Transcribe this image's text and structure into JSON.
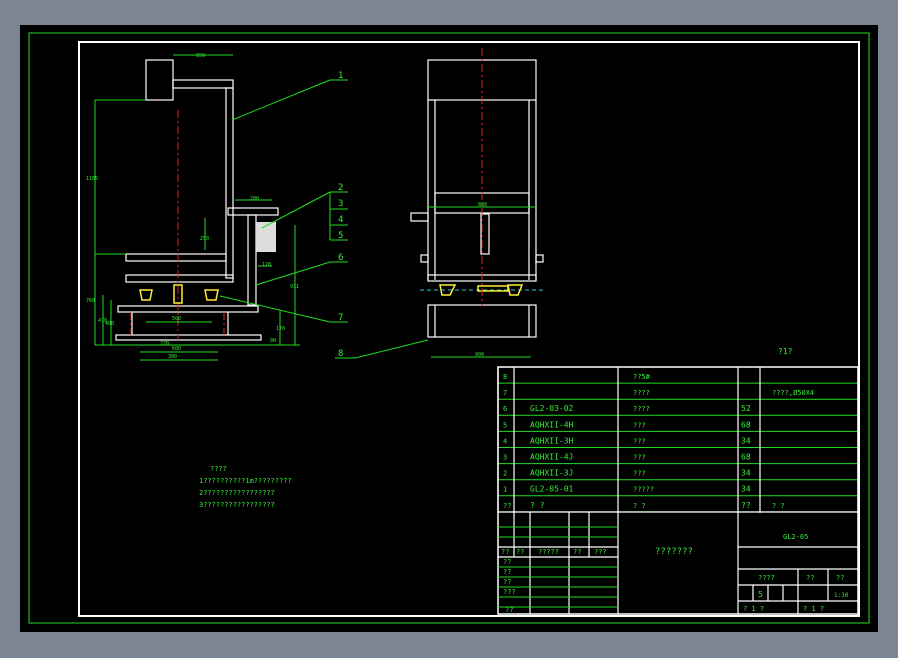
{
  "drawing": {
    "balloons": [
      "1",
      "2",
      "3",
      "4",
      "5",
      "6",
      "7",
      "8"
    ],
    "side_dims": [
      "650",
      "1165",
      "760",
      "470",
      "400",
      "250",
      "500",
      "600",
      "911",
      "200",
      "90",
      "170",
      "120",
      "270",
      "380"
    ],
    "front_dims": [
      "880",
      "900"
    ],
    "notes": {
      "title": "????",
      "lines": [
        "1??????????1m?????????",
        "2?????????????????",
        "3?????????????????"
      ]
    },
    "scale_note": "?1?"
  },
  "parts_table": {
    "rows": [
      {
        "no": "8",
        "code": "",
        "name": "??5#",
        "qty": "",
        "remark": ""
      },
      {
        "no": "7",
        "code": "",
        "name": "????",
        "qty": "",
        "remark": "????,Ø50X4"
      },
      {
        "no": "6",
        "code": "GL2-03-02",
        "name": "????",
        "qty": "52",
        "remark": ""
      },
      {
        "no": "5",
        "code": "AQHXII-4H",
        "name": "???",
        "qty": "68",
        "remark": ""
      },
      {
        "no": "4",
        "code": "AQHXII-3H",
        "name": "???",
        "qty": "34",
        "remark": ""
      },
      {
        "no": "3",
        "code": "AQHXII-4J",
        "name": "???",
        "qty": "68",
        "remark": ""
      },
      {
        "no": "2",
        "code": "AQHXII-3J",
        "name": "???",
        "qty": "34",
        "remark": ""
      },
      {
        "no": "1",
        "code": "GL2-05-01",
        "name": "?????",
        "qty": "34",
        "remark": ""
      }
    ],
    "header": {
      "no": "??",
      "code": "?  ?",
      "name": "?  ?",
      "qty": "??",
      "remark": "?  ?"
    }
  },
  "title_block": {
    "revision_header": [
      "??",
      "??",
      "?????",
      "??",
      "???"
    ],
    "sign_rows": [
      "??",
      "??",
      "??",
      "???",
      "",
      "??"
    ],
    "drawing_title": "???????",
    "drawing_number": "GL2-05",
    "label_stage": "????",
    "label_weight": "??",
    "label_scale": "??",
    "stage_value": "5",
    "scale_value": "1:10",
    "sheet_total": "? 1 ?",
    "sheet_no": "? 1 ?"
  }
}
